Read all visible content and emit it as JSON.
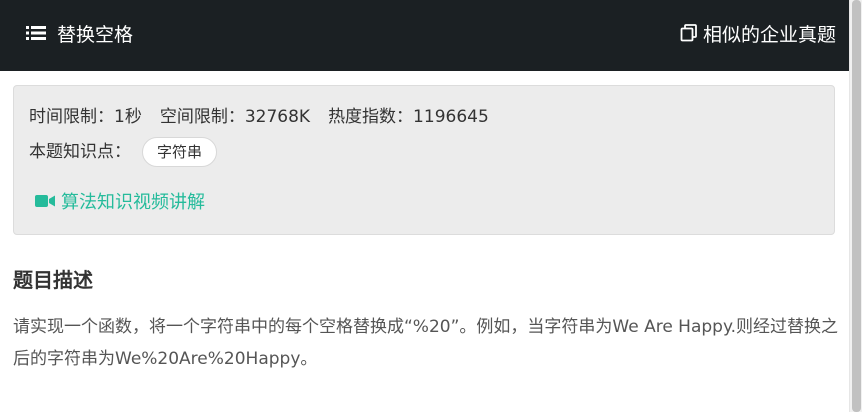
{
  "header": {
    "title": "替换空格",
    "list_icon": "list-icon",
    "right_icon": "copy-icon",
    "right_label": "相似的企业真题"
  },
  "info": {
    "time_limit": "时间限制：1秒",
    "space_limit": "空间限制：32768K",
    "heat_index": "热度指数：1196645",
    "knowledge_label": "本题知识点：",
    "knowledge_tags": [
      "字符串"
    ],
    "video_icon": "video-camera-icon",
    "video_link": "算法知识视频讲解"
  },
  "section": {
    "title": "题目描述",
    "description": "请实现一个函数，将一个字符串中的每个空格替换成“%20”。例如，当字符串为We Are Happy.则经过替换之后的字符串为We%20Are%20Happy。"
  },
  "colors": {
    "header_bg": "#1b2023",
    "accent_green": "#25bb9b",
    "info_bg": "#ececec"
  }
}
